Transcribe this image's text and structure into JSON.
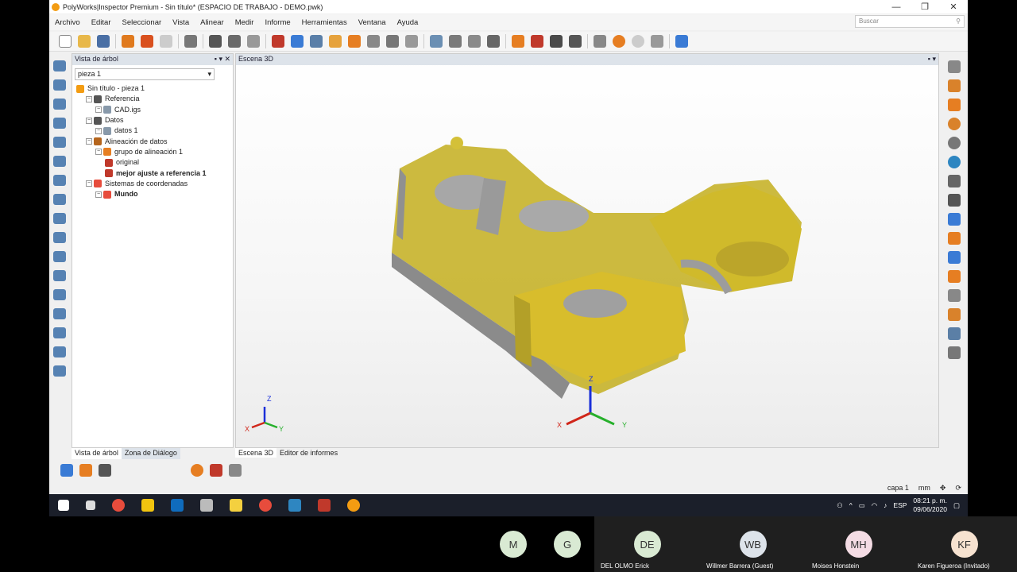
{
  "window": {
    "title": "PolyWorks|Inspector Premium - Sin título* (ESPACIO DE TRABAJO  - DEMO.pwk)",
    "controls": [
      "—",
      "❐",
      "✕"
    ]
  },
  "menu": [
    "Archivo",
    "Editar",
    "Seleccionar",
    "Vista",
    "Alinear",
    "Medir",
    "Informe",
    "Herramientas",
    "Ventana",
    "Ayuda"
  ],
  "search": {
    "placeholder": "Buscar"
  },
  "tree_panel": {
    "title": "Vista de árbol",
    "selector_value": "pieza 1",
    "nodes": [
      {
        "label": "Sin título - pieza 1",
        "indent": 0,
        "bold": false,
        "color": "#f39c12"
      },
      {
        "label": "Referencia",
        "indent": 1,
        "bold": false,
        "color": "#555555"
      },
      {
        "label": "CAD.igs",
        "indent": 2,
        "bold": false,
        "color": "#8899aa"
      },
      {
        "label": "Datos",
        "indent": 1,
        "bold": false,
        "color": "#555555"
      },
      {
        "label": "datos 1",
        "indent": 2,
        "bold": false,
        "color": "#8899aa"
      },
      {
        "label": "Alineación de datos",
        "indent": 1,
        "bold": false,
        "color": "#b5651d"
      },
      {
        "label": "grupo de alineación 1",
        "indent": 2,
        "bold": false,
        "color": "#e67e22"
      },
      {
        "label": "original",
        "indent": 3,
        "bold": false,
        "color": "#c0392b"
      },
      {
        "label": "mejor ajuste a referencia 1",
        "indent": 3,
        "bold": true,
        "color": "#c0392b"
      },
      {
        "label": "Sistemas de coordenadas",
        "indent": 1,
        "bold": false,
        "color": "#e74c3c"
      },
      {
        "label": "Mundo",
        "indent": 2,
        "bold": true,
        "color": "#e74c3c"
      }
    ],
    "tabs": [
      "Vista de árbol",
      "Zona de Diálogo"
    ]
  },
  "scene": {
    "title": "Escena 3D",
    "tabs": [
      "Escena 3D",
      "Editor de informes"
    ],
    "axes_small": {
      "x": "X",
      "y": "Y",
      "z": "Z"
    },
    "axes_large": {
      "x": "X",
      "y": "Y",
      "z": "Z"
    }
  },
  "status": {
    "layer": "capa 1",
    "unit": "mm"
  },
  "taskbar": {
    "lang": "ESP",
    "time": "08:21 p. m.",
    "date": "09/06/2020"
  },
  "participants": [
    {
      "initials": "M",
      "name": "",
      "color": "#d9ead3"
    },
    {
      "initials": "G",
      "name": "",
      "color": "#d9ead3"
    },
    {
      "initials": "DE",
      "name": "DEL OLMO Erick",
      "color": "#d9ead3"
    },
    {
      "initials": "WB",
      "name": "Willmer Barrera (Guest)",
      "color": "#dde3ea"
    },
    {
      "initials": "MH",
      "name": "Moises Honstein",
      "color": "#f4dce4"
    },
    {
      "initials": "KF",
      "name": "Karen Figueroa (Invitado)",
      "color": "#f6e2d0"
    }
  ]
}
